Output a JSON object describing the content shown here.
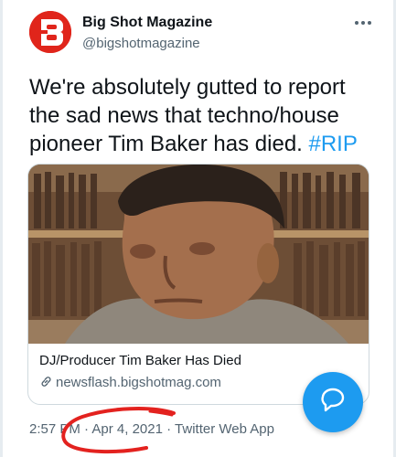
{
  "account": {
    "display_name": "Big Shot Magazine",
    "handle": "@bigshotmagazine"
  },
  "tweet": {
    "text": "We're absolutely gutted to report the sad news that techno/house pioneer Tim Baker has died.",
    "hashtag": "#RIP"
  },
  "card": {
    "title": "DJ/Producer Tim Baker Has Died",
    "domain": "newsflash.bigshotmag.com"
  },
  "meta": {
    "time": "2:57 PM",
    "separator": "·",
    "date": "Apr 4, 2021",
    "source": "Twitter Web App"
  },
  "icons": {
    "avatar": "magazine-logo-icon",
    "more": "more-options-icon",
    "link": "link-icon",
    "compose": "compose-reply-icon"
  },
  "colors": {
    "accent": "#1d9bf0",
    "brand": "#e0251b",
    "annotation": "#e3221f"
  }
}
